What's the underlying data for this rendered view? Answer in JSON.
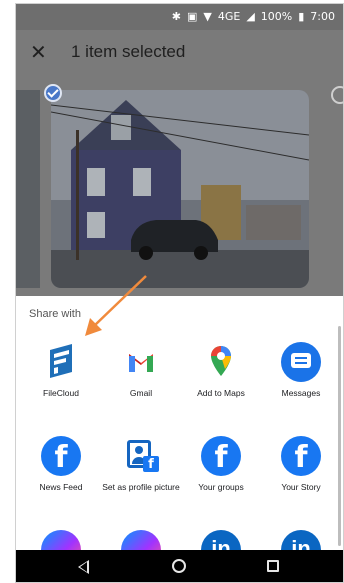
{
  "status_bar": {
    "indicators": [
      "bluetooth-icon",
      "nfc-icon",
      "wifi-icon",
      "lte-signal-icon"
    ],
    "network": "4GE",
    "battery": "100%",
    "time": "7:00"
  },
  "header": {
    "title": "1 item selected"
  },
  "share_sheet": {
    "heading": "Share with",
    "apps": [
      {
        "label": "FileCloud",
        "icon": "filecloud-icon"
      },
      {
        "label": "Gmail",
        "icon": "gmail-icon"
      },
      {
        "label": "Add to Maps",
        "icon": "google-maps-icon"
      },
      {
        "label": "Messages",
        "icon": "messages-icon"
      },
      {
        "label": "News Feed",
        "icon": "facebook-icon"
      },
      {
        "label": "Set as profile picture",
        "icon": "facebook-profile-icon"
      },
      {
        "label": "Your groups",
        "icon": "facebook-icon"
      },
      {
        "label": "Your Story",
        "icon": "facebook-icon"
      },
      {
        "label": "",
        "icon": "messenger-icon"
      },
      {
        "label": "",
        "icon": "messenger-icon"
      },
      {
        "label": "",
        "icon": "linkedin-icon"
      },
      {
        "label": "",
        "icon": "linkedin-icon"
      }
    ]
  },
  "colors": {
    "facebook": "#1877f2",
    "arrow": "#f08a3c",
    "scrim": "#7a7a7a"
  }
}
